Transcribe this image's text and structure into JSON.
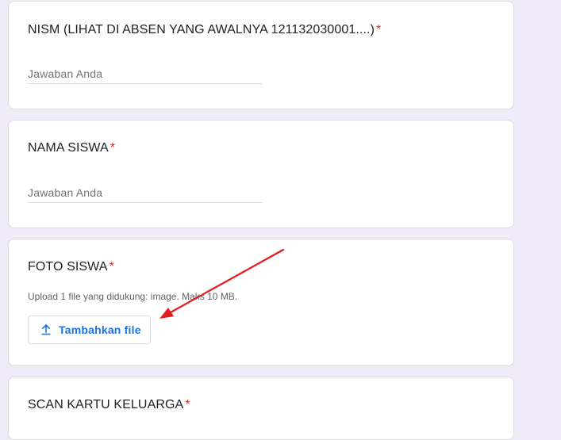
{
  "questions": [
    {
      "title": "NISM (LIHAT DI ABSEN YANG AWALNYA 121132030001....)",
      "required_mark": "*",
      "answer_placeholder": "Jawaban Anda"
    },
    {
      "title": "NAMA SISWA",
      "required_mark": "*",
      "answer_placeholder": "Jawaban Anda"
    },
    {
      "title": "FOTO SISWA",
      "required_mark": "*",
      "upload_hint": "Upload 1 file yang didukung: image. Maks 10 MB.",
      "upload_button_label": "Tambahkan file",
      "upload_icon": "upload-icon"
    },
    {
      "title": "SCAN KARTU KELUARGA",
      "required_mark": "*"
    }
  ],
  "annotation": {
    "type": "red-arrow",
    "color": "#e21b1b",
    "points_to": "upload-button"
  },
  "colors": {
    "page_background": "#f0ebf8",
    "required": "#d93025",
    "accent": "#1a73e8"
  }
}
